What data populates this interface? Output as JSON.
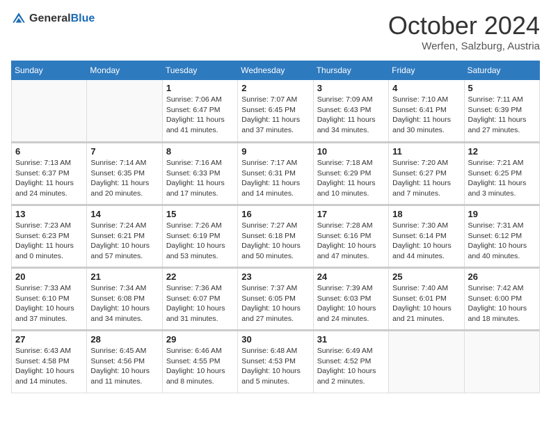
{
  "header": {
    "logo_general": "General",
    "logo_blue": "Blue",
    "month_title": "October 2024",
    "subtitle": "Werfen, Salzburg, Austria"
  },
  "days_of_week": [
    "Sunday",
    "Monday",
    "Tuesday",
    "Wednesday",
    "Thursday",
    "Friday",
    "Saturday"
  ],
  "weeks": [
    [
      {
        "day": "",
        "info": ""
      },
      {
        "day": "",
        "info": ""
      },
      {
        "day": "1",
        "info": "Sunrise: 7:06 AM\nSunset: 6:47 PM\nDaylight: 11 hours and 41 minutes."
      },
      {
        "day": "2",
        "info": "Sunrise: 7:07 AM\nSunset: 6:45 PM\nDaylight: 11 hours and 37 minutes."
      },
      {
        "day": "3",
        "info": "Sunrise: 7:09 AM\nSunset: 6:43 PM\nDaylight: 11 hours and 34 minutes."
      },
      {
        "day": "4",
        "info": "Sunrise: 7:10 AM\nSunset: 6:41 PM\nDaylight: 11 hours and 30 minutes."
      },
      {
        "day": "5",
        "info": "Sunrise: 7:11 AM\nSunset: 6:39 PM\nDaylight: 11 hours and 27 minutes."
      }
    ],
    [
      {
        "day": "6",
        "info": "Sunrise: 7:13 AM\nSunset: 6:37 PM\nDaylight: 11 hours and 24 minutes."
      },
      {
        "day": "7",
        "info": "Sunrise: 7:14 AM\nSunset: 6:35 PM\nDaylight: 11 hours and 20 minutes."
      },
      {
        "day": "8",
        "info": "Sunrise: 7:16 AM\nSunset: 6:33 PM\nDaylight: 11 hours and 17 minutes."
      },
      {
        "day": "9",
        "info": "Sunrise: 7:17 AM\nSunset: 6:31 PM\nDaylight: 11 hours and 14 minutes."
      },
      {
        "day": "10",
        "info": "Sunrise: 7:18 AM\nSunset: 6:29 PM\nDaylight: 11 hours and 10 minutes."
      },
      {
        "day": "11",
        "info": "Sunrise: 7:20 AM\nSunset: 6:27 PM\nDaylight: 11 hours and 7 minutes."
      },
      {
        "day": "12",
        "info": "Sunrise: 7:21 AM\nSunset: 6:25 PM\nDaylight: 11 hours and 3 minutes."
      }
    ],
    [
      {
        "day": "13",
        "info": "Sunrise: 7:23 AM\nSunset: 6:23 PM\nDaylight: 11 hours and 0 minutes."
      },
      {
        "day": "14",
        "info": "Sunrise: 7:24 AM\nSunset: 6:21 PM\nDaylight: 10 hours and 57 minutes."
      },
      {
        "day": "15",
        "info": "Sunrise: 7:26 AM\nSunset: 6:19 PM\nDaylight: 10 hours and 53 minutes."
      },
      {
        "day": "16",
        "info": "Sunrise: 7:27 AM\nSunset: 6:18 PM\nDaylight: 10 hours and 50 minutes."
      },
      {
        "day": "17",
        "info": "Sunrise: 7:28 AM\nSunset: 6:16 PM\nDaylight: 10 hours and 47 minutes."
      },
      {
        "day": "18",
        "info": "Sunrise: 7:30 AM\nSunset: 6:14 PM\nDaylight: 10 hours and 44 minutes."
      },
      {
        "day": "19",
        "info": "Sunrise: 7:31 AM\nSunset: 6:12 PM\nDaylight: 10 hours and 40 minutes."
      }
    ],
    [
      {
        "day": "20",
        "info": "Sunrise: 7:33 AM\nSunset: 6:10 PM\nDaylight: 10 hours and 37 minutes."
      },
      {
        "day": "21",
        "info": "Sunrise: 7:34 AM\nSunset: 6:08 PM\nDaylight: 10 hours and 34 minutes."
      },
      {
        "day": "22",
        "info": "Sunrise: 7:36 AM\nSunset: 6:07 PM\nDaylight: 10 hours and 31 minutes."
      },
      {
        "day": "23",
        "info": "Sunrise: 7:37 AM\nSunset: 6:05 PM\nDaylight: 10 hours and 27 minutes."
      },
      {
        "day": "24",
        "info": "Sunrise: 7:39 AM\nSunset: 6:03 PM\nDaylight: 10 hours and 24 minutes."
      },
      {
        "day": "25",
        "info": "Sunrise: 7:40 AM\nSunset: 6:01 PM\nDaylight: 10 hours and 21 minutes."
      },
      {
        "day": "26",
        "info": "Sunrise: 7:42 AM\nSunset: 6:00 PM\nDaylight: 10 hours and 18 minutes."
      }
    ],
    [
      {
        "day": "27",
        "info": "Sunrise: 6:43 AM\nSunset: 4:58 PM\nDaylight: 10 hours and 14 minutes."
      },
      {
        "day": "28",
        "info": "Sunrise: 6:45 AM\nSunset: 4:56 PM\nDaylight: 10 hours and 11 minutes."
      },
      {
        "day": "29",
        "info": "Sunrise: 6:46 AM\nSunset: 4:55 PM\nDaylight: 10 hours and 8 minutes."
      },
      {
        "day": "30",
        "info": "Sunrise: 6:48 AM\nSunset: 4:53 PM\nDaylight: 10 hours and 5 minutes."
      },
      {
        "day": "31",
        "info": "Sunrise: 6:49 AM\nSunset: 4:52 PM\nDaylight: 10 hours and 2 minutes."
      },
      {
        "day": "",
        "info": ""
      },
      {
        "day": "",
        "info": ""
      }
    ]
  ]
}
